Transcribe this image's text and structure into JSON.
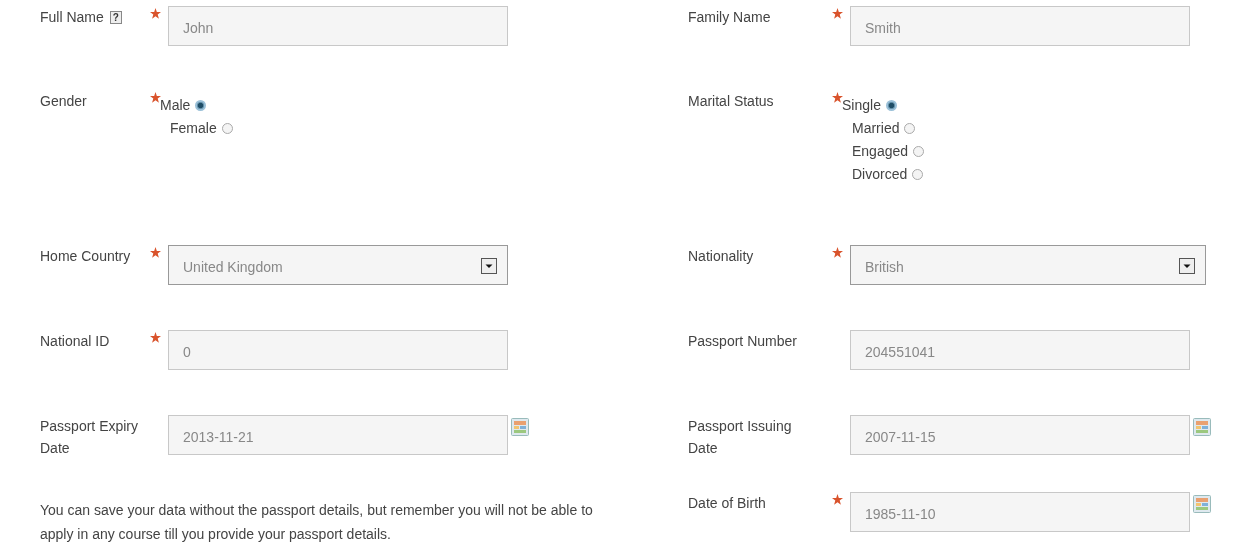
{
  "rows": [
    {
      "left": {
        "label": "Full Name",
        "help_mark": "?",
        "required": true,
        "kind": "text",
        "value": "John"
      },
      "right": {
        "label": "Family Name",
        "required": true,
        "kind": "text",
        "value": "Smith"
      }
    },
    {
      "left": {
        "label": "Gender",
        "required": true,
        "kind": "radio",
        "options": [
          {
            "label": "Male",
            "selected": true
          },
          {
            "label": "Female",
            "selected": false
          }
        ]
      },
      "right": {
        "label": "Marital Status",
        "required": true,
        "kind": "radio",
        "options": [
          {
            "label": "Single",
            "selected": true
          },
          {
            "label": "Married",
            "selected": false
          },
          {
            "label": "Engaged",
            "selected": false
          },
          {
            "label": "Divorced",
            "selected": false
          }
        ]
      }
    },
    {
      "left": {
        "label": "Home Country",
        "required": true,
        "kind": "select",
        "value": "United Kingdom"
      },
      "right": {
        "label": "Nationality",
        "required": true,
        "kind": "select",
        "value": "British"
      }
    },
    {
      "left": {
        "label": "National ID",
        "required": true,
        "kind": "text",
        "value": "0"
      },
      "right": {
        "label": "Passport Number",
        "required": false,
        "kind": "text",
        "value": "204551041"
      }
    },
    {
      "left": {
        "label": "Passport Expiry Date",
        "required": false,
        "kind": "date",
        "value": "2013-11-21"
      },
      "right": {
        "label": "Passport Issuing Date",
        "required": false,
        "kind": "date",
        "value": "2007-11-15"
      }
    },
    {
      "left": {
        "kind": "note",
        "text": "You can save your data without the passport details, but remember you will not be able to apply in any course till you provide your passport details."
      },
      "right": {
        "label": "Date of Birth",
        "required": true,
        "kind": "date",
        "value": "1985-11-10"
      }
    }
  ]
}
